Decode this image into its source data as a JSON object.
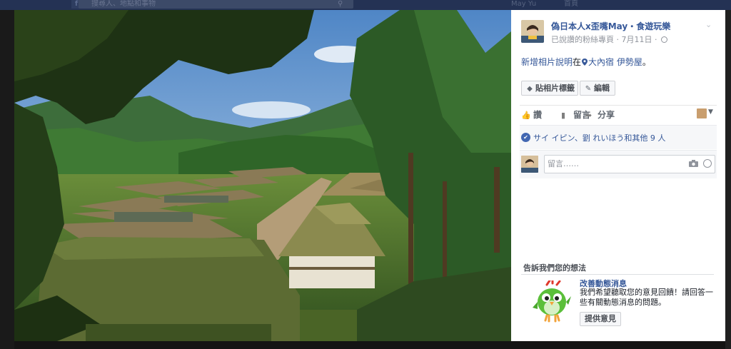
{
  "background_page": {
    "search_placeholder": "搜尋人、地點和事物",
    "user_name": "May Yu",
    "home_label": "首頁"
  },
  "photo": {
    "description_icon": "photo-village-landscape"
  },
  "post": {
    "page_name": "偽日本人x歪嘴May・食遊玩樂",
    "meta_prefix": "已說讚的粉絲專頁",
    "separator": " · ",
    "date": "7月11日",
    "caption_prefix": "新增相片說明",
    "caption_at": "在",
    "location": "大內宿 伊勢屋",
    "caption_suffix": "。",
    "tag_photo_label": "貼相片標籤",
    "edit_label": "編輯"
  },
  "actions": {
    "like_label": "讚",
    "comment_label": "留言",
    "share_label": "分享"
  },
  "reactions": {
    "text": "サイ イピン、劉 れいほう和其他 9 人"
  },
  "comment": {
    "placeholder": "留言……"
  },
  "feedback": {
    "title": "告訴我們您的想法",
    "heading": "改善動態消息",
    "body": "我們希望聽取您的意見回饋！請回答一些有關動態消息的問題。",
    "button_label": "提供意見"
  },
  "colors": {
    "link": "#365899",
    "like_badge": "#4267b2",
    "topbar": "#243254"
  }
}
